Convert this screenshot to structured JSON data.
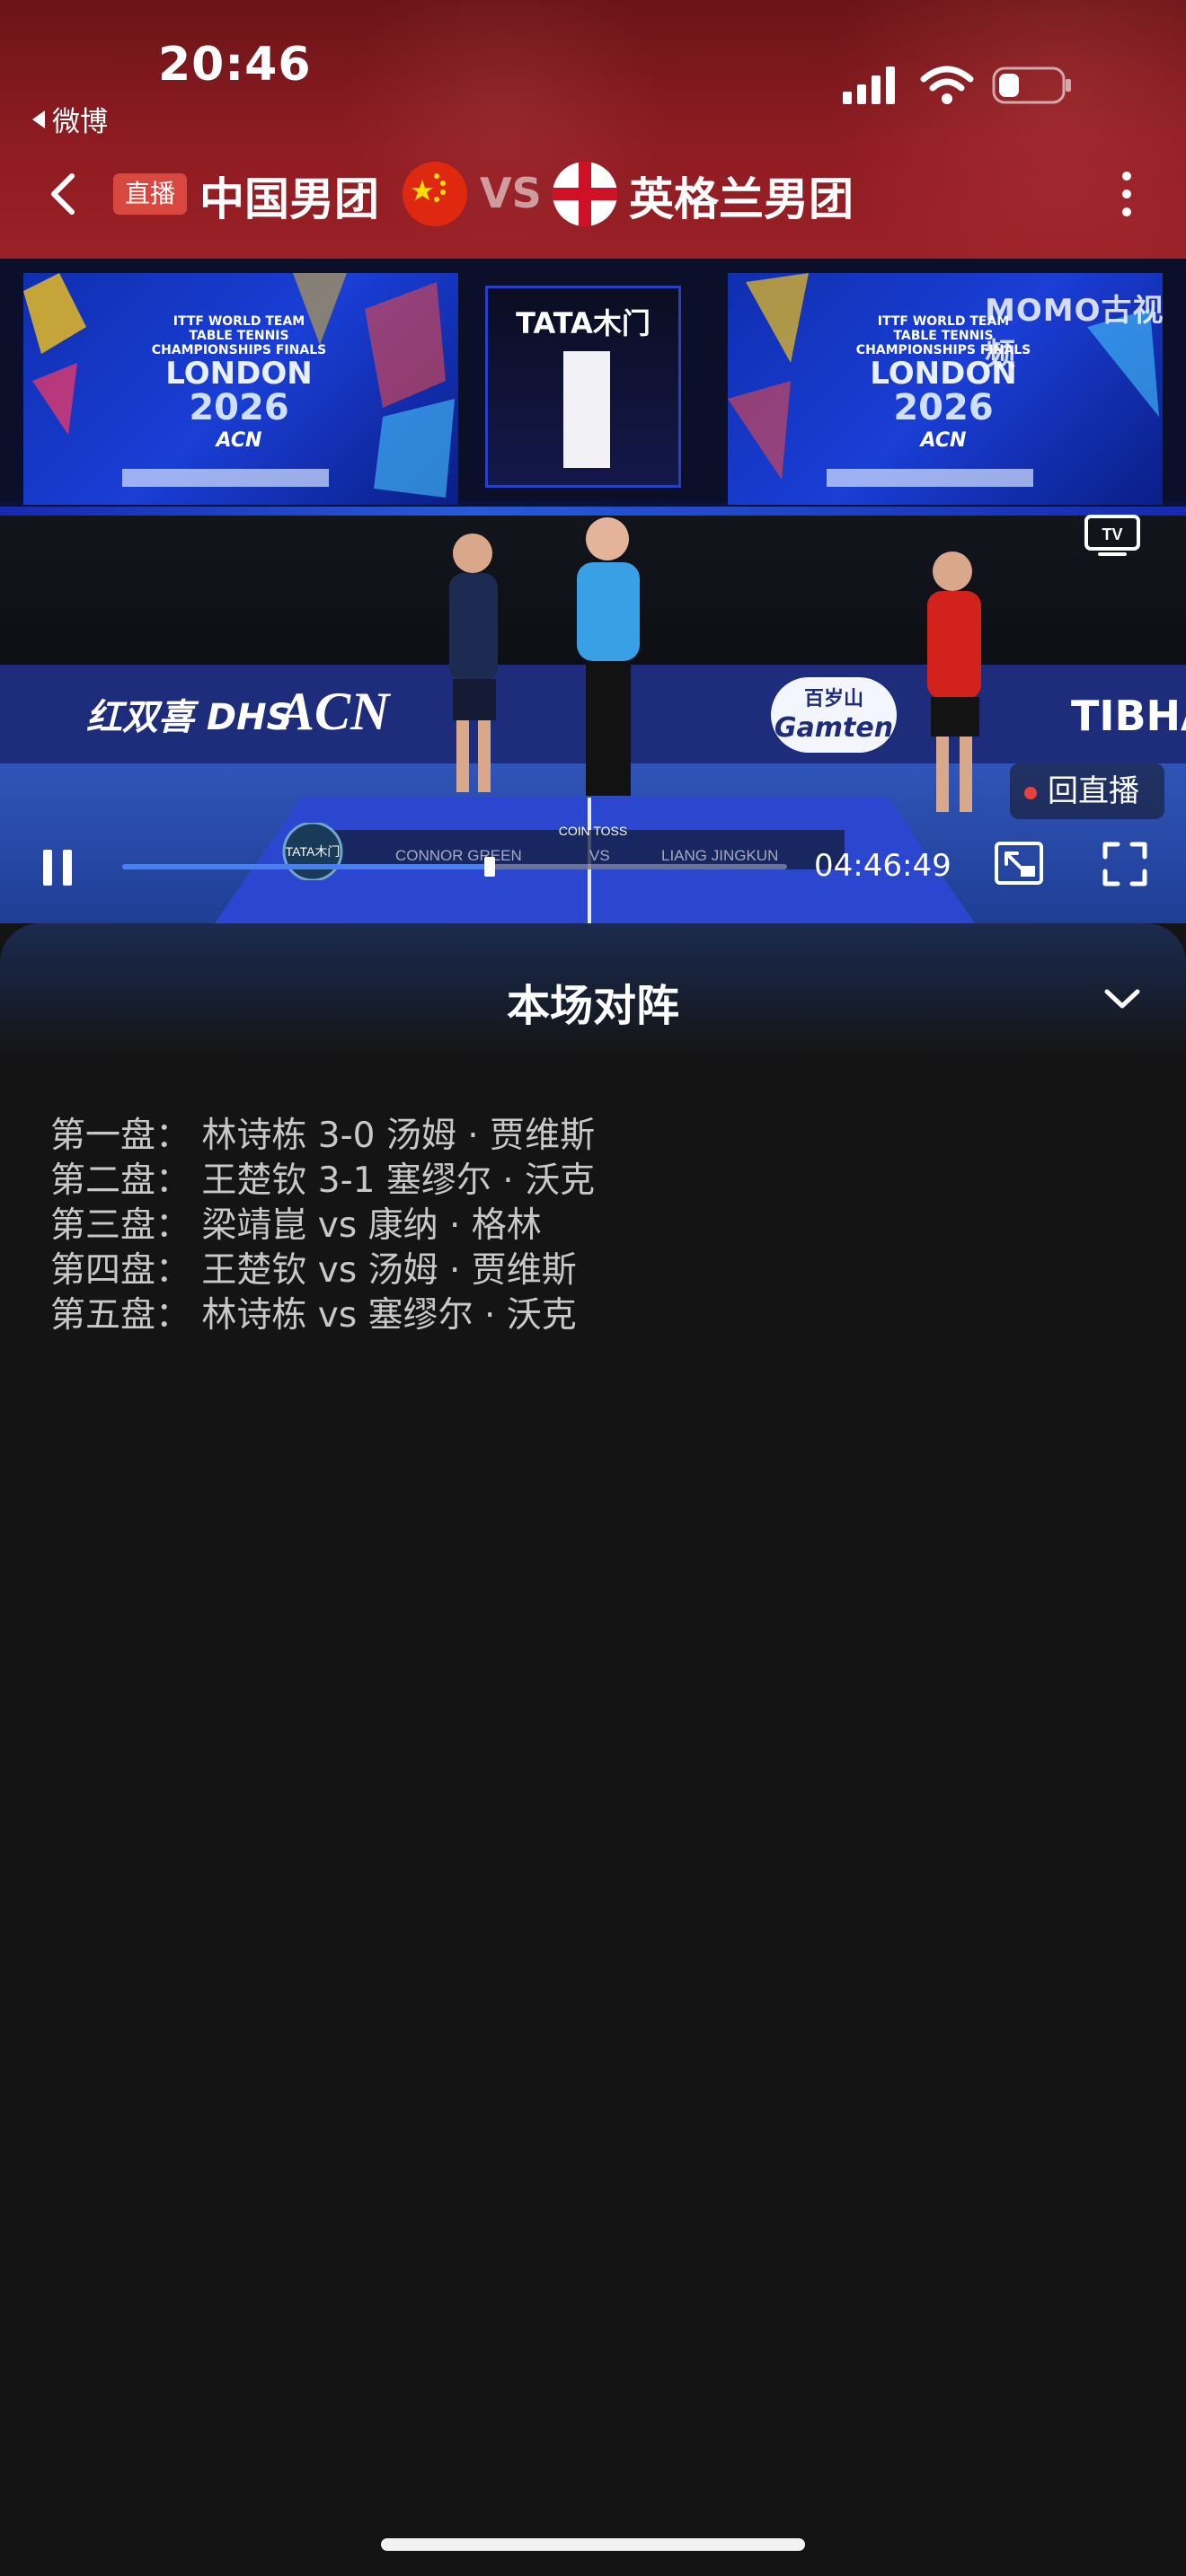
{
  "status_bar": {
    "time": "20:46",
    "back_app_label": "微博"
  },
  "header": {
    "live_badge": "直播",
    "team_home": "中国男团",
    "vs": "VS",
    "team_away": "英格兰男团",
    "home_flag_icon": "china-flag-icon",
    "away_flag_icon": "england-flag-icon"
  },
  "video": {
    "center_screen_brand": "TATA木门",
    "event_line1": "ITTF WORLD TEAM",
    "event_line2": "TABLE TENNIS",
    "event_line3": "CHAMPIONSHIPS FINALS",
    "event_city": "LONDON",
    "event_year": "2026",
    "event_sponsor": "ACN",
    "watermark": "MOMO古视频",
    "tv_label": "TV",
    "ad_left": "红双喜 DHS",
    "ad_acn": "ACN",
    "ad_gamten_cn": "百岁山",
    "ad_gamten": "Gamten",
    "ad_right": "TIBHAR",
    "replay_button": "回直播",
    "scoreboard_header": "COIN TOSS",
    "scoreboard_logo": "TATA木门",
    "scoreboard_player1": "CONNOR GREEN",
    "scoreboard_vs": "VS",
    "scoreboard_player2": "LIANG JINGKUN",
    "current_time": "04:46:49",
    "progress_fraction": 0.553,
    "accent_color": "#4a7ff0"
  },
  "lineup": {
    "title": "本场对阵",
    "matches": [
      "第一盘：  林诗栋  3-0  汤姆 · 贾维斯",
      "第二盘：  王楚钦  3-1  塞缪尔 · 沃克",
      "第三盘：  梁靖崑  vs  康纳 · 格林",
      "第四盘：  王楚钦  vs  汤姆 · 贾维斯",
      "第五盘：  林诗栋  vs  塞缪尔 · 沃克"
    ]
  }
}
